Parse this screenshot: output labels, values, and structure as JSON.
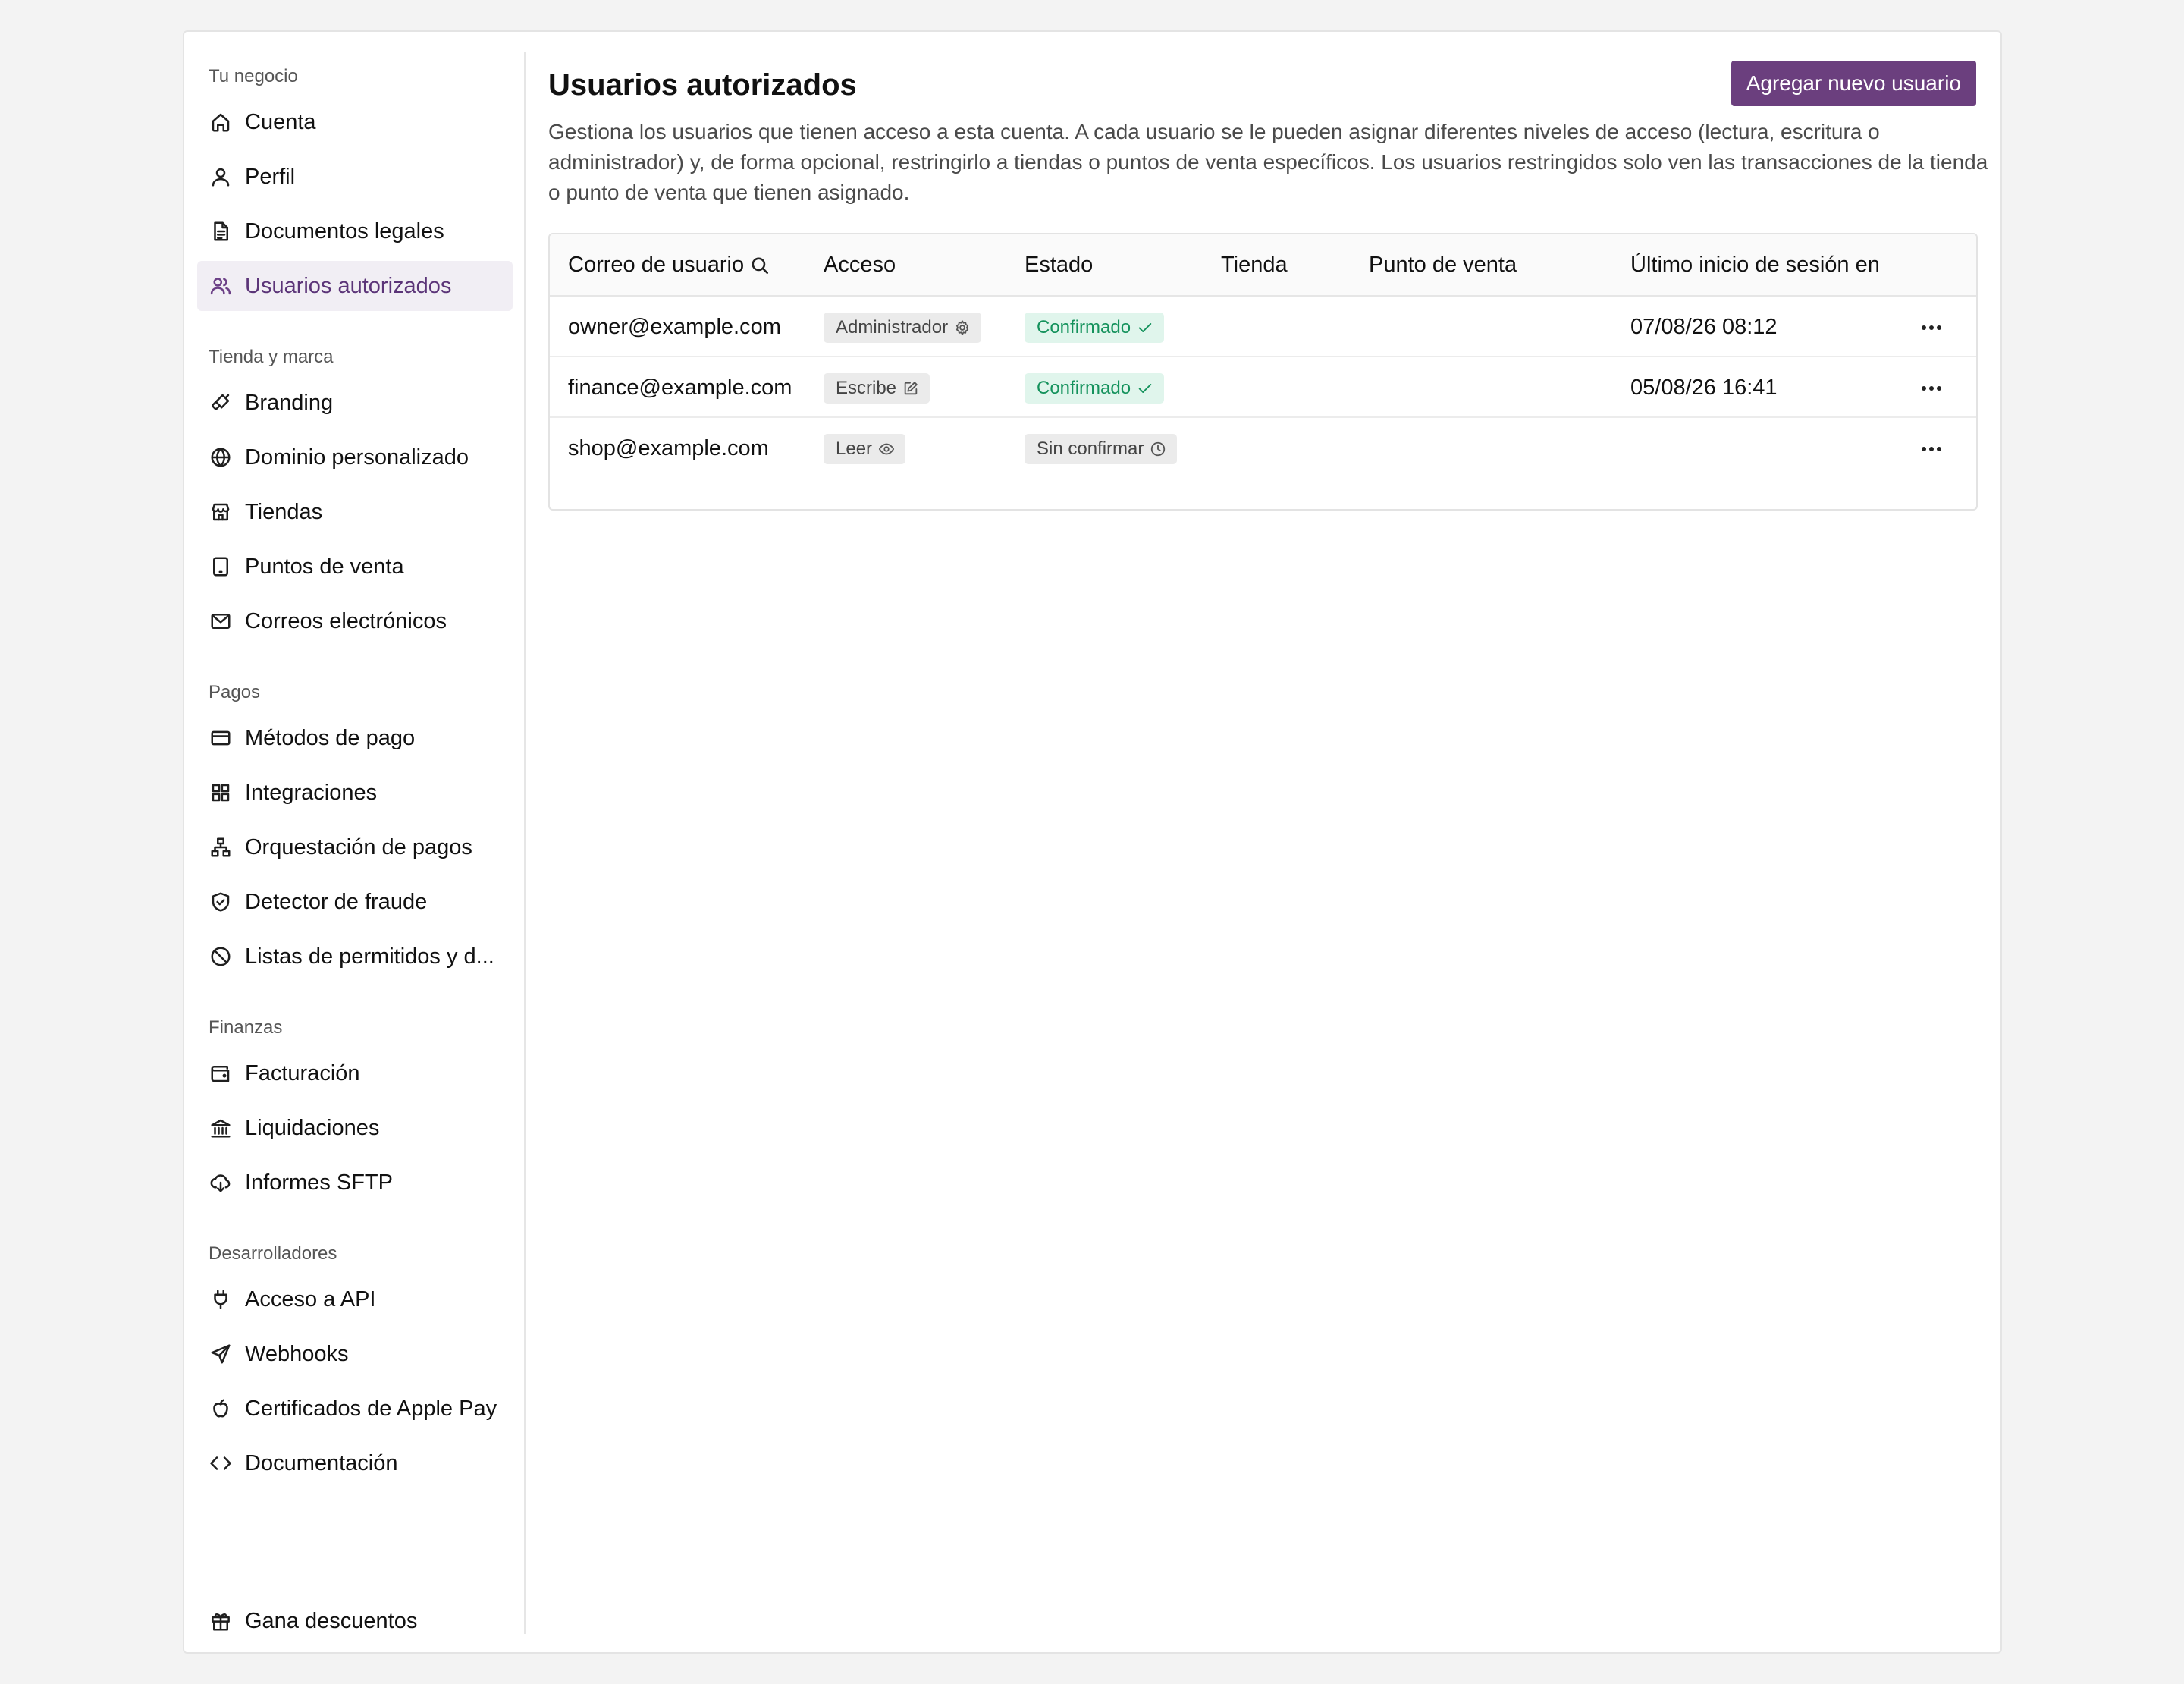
{
  "colors": {
    "accent": "#6b3f7e",
    "active_bg": "#f1eef4",
    "confirmed_bg": "#e0f5ec",
    "confirmed_text": "#14925c",
    "neutral_badge_bg": "#ebebeb"
  },
  "sidebar": {
    "groups": [
      {
        "title": "Tu negocio",
        "items": [
          {
            "label": "Cuenta",
            "icon": "home-icon"
          },
          {
            "label": "Perfil",
            "icon": "user-icon"
          },
          {
            "label": "Documentos legales",
            "icon": "document-icon"
          },
          {
            "label": "Usuarios autorizados",
            "icon": "users-icon",
            "active": true
          }
        ]
      },
      {
        "title": "Tienda y marca",
        "items": [
          {
            "label": "Branding",
            "icon": "brush-icon"
          },
          {
            "label": "Dominio personalizado",
            "icon": "globe-icon"
          },
          {
            "label": "Tiendas",
            "icon": "store-icon"
          },
          {
            "label": "Puntos de venta",
            "icon": "tablet-icon"
          },
          {
            "label": "Correos electrónicos",
            "icon": "mail-icon"
          }
        ]
      },
      {
        "title": "Pagos",
        "items": [
          {
            "label": "Métodos de pago",
            "icon": "credit-card-icon"
          },
          {
            "label": "Integraciones",
            "icon": "grid-icon"
          },
          {
            "label": "Orquestación de pagos",
            "icon": "network-icon"
          },
          {
            "label": "Detector de fraude",
            "icon": "shield-check-icon"
          },
          {
            "label": "Listas de permitidos y d...",
            "icon": "ban-icon"
          }
        ]
      },
      {
        "title": "Finanzas",
        "items": [
          {
            "label": "Facturación",
            "icon": "wallet-icon"
          },
          {
            "label": "Liquidaciones",
            "icon": "bank-icon"
          },
          {
            "label": "Informes SFTP",
            "icon": "cloud-download-icon"
          }
        ]
      },
      {
        "title": "Desarrolladores",
        "items": [
          {
            "label": "Acceso a API",
            "icon": "plug-icon"
          },
          {
            "label": "Webhooks",
            "icon": "send-icon"
          },
          {
            "label": "Certificados de Apple Pay",
            "icon": "apple-icon"
          },
          {
            "label": "Documentación",
            "icon": "code-icon"
          }
        ]
      },
      {
        "title": "",
        "items": [
          {
            "label": "Gana descuentos",
            "icon": "gift-icon"
          }
        ]
      }
    ]
  },
  "main": {
    "title": "Usuarios autorizados",
    "add_button": "Agregar nuevo usuario",
    "description": "Gestiona los usuarios que tienen acceso a esta cuenta. A cada usuario se le pueden asignar diferentes niveles de acceso (lectura, escritura o administrador) y, de forma opcional, restringirlo a tiendas o puntos de venta específicos. Los usuarios restringidos solo ven las transacciones de la tienda o punto de venta que tienen asignado."
  },
  "table": {
    "headers": {
      "email": "Correo de usuario",
      "access": "Acceso",
      "status": "Estado",
      "store": "Tienda",
      "pos": "Punto de venta",
      "last_login": "Último inicio de sesión en"
    },
    "rows": [
      {
        "email": "owner@example.com",
        "access": "Administrador",
        "access_icon": "gear-icon",
        "status": "Confirmado",
        "status_icon": "check-icon",
        "status_type": "confirmed",
        "store": "",
        "pos": "",
        "last_login": "07/08/26 08:12"
      },
      {
        "email": "finance@example.com",
        "access": "Escribe",
        "access_icon": "edit-icon",
        "status": "Confirmado",
        "status_icon": "check-icon",
        "status_type": "confirmed",
        "store": "",
        "pos": "",
        "last_login": "05/08/26 16:41"
      },
      {
        "email": "shop@example.com",
        "access": "Leer",
        "access_icon": "eye-icon",
        "status": "Sin confirmar",
        "status_icon": "clock-icon",
        "status_type": "pending",
        "store": "",
        "pos": "",
        "last_login": ""
      }
    ]
  }
}
